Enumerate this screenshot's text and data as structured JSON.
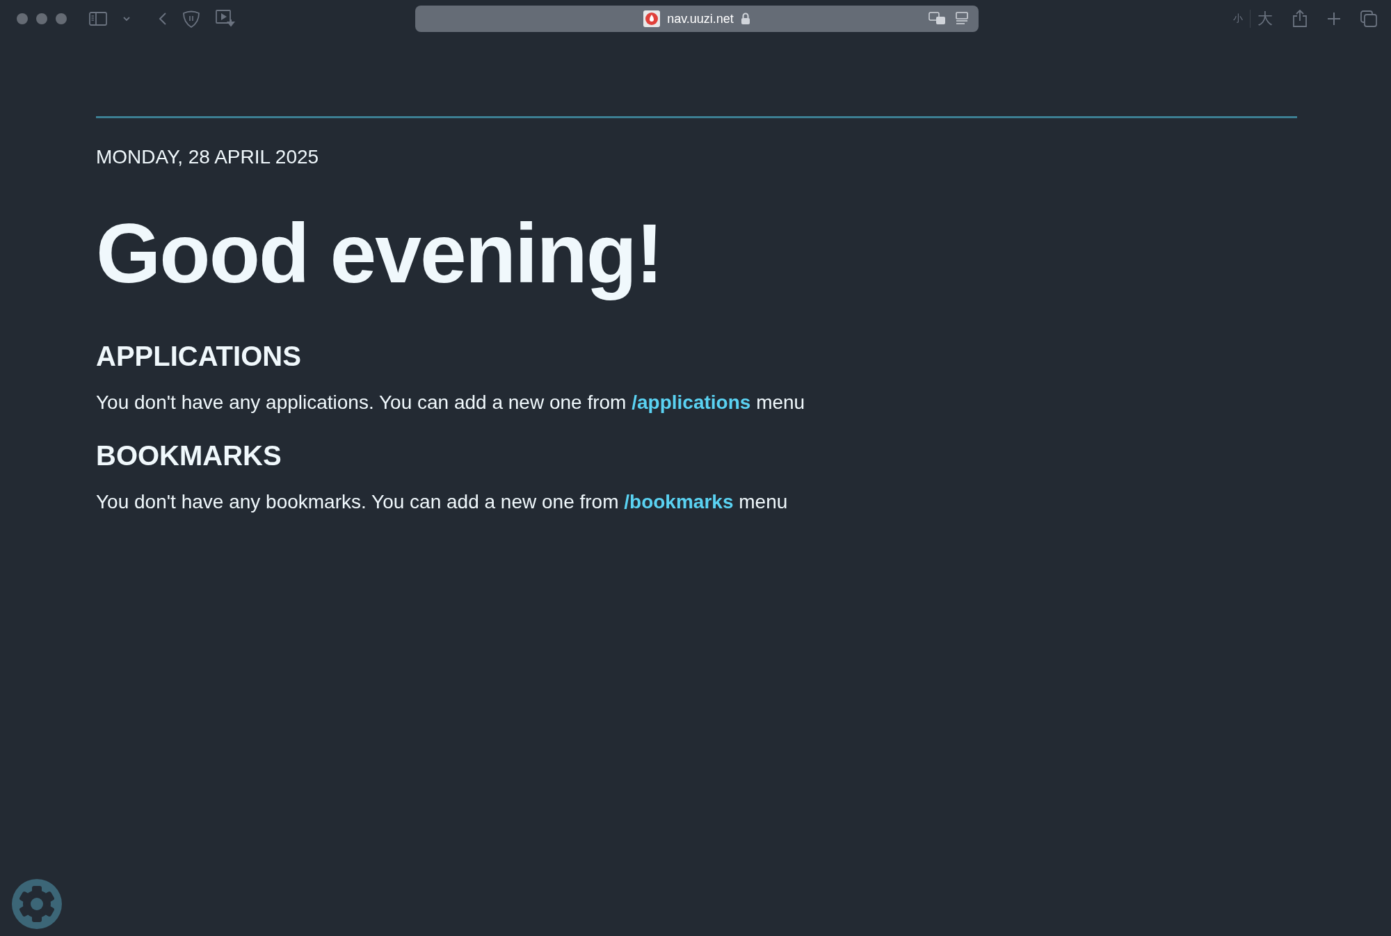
{
  "browser": {
    "address": "nav.uuzi.net",
    "text_size_small": "小",
    "text_size_large": "大"
  },
  "date": "MONDAY, 28 APRIL 2025",
  "greeting": "Good evening!",
  "sections": [
    {
      "heading": "APPLICATIONS",
      "text_before": "You don't have any applications. You can add a new one from ",
      "link": "/applications",
      "text_after": " menu"
    },
    {
      "heading": "BOOKMARKS",
      "text_before": "You don't have any bookmarks. You can add a new one from ",
      "link": "/bookmarks",
      "text_after": " menu"
    }
  ]
}
